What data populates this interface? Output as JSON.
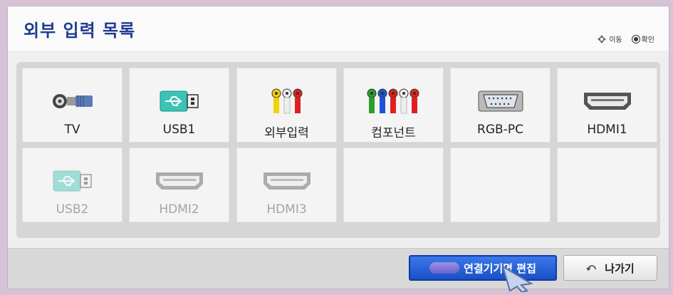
{
  "title": "외부 입력 목록",
  "hints": {
    "move": "이동",
    "ok": "확인"
  },
  "inputs": [
    {
      "label": "TV",
      "icon": "tv-antenna-icon",
      "enabled": true
    },
    {
      "label": "USB1",
      "icon": "usb-icon",
      "enabled": true
    },
    {
      "label": "외부입력",
      "icon": "av-rca-icon",
      "enabled": true
    },
    {
      "label": "컴포넌트",
      "icon": "component-icon",
      "enabled": true
    },
    {
      "label": "RGB-PC",
      "icon": "rgb-pc-icon",
      "enabled": true
    },
    {
      "label": "HDMI1",
      "icon": "hdmi-icon",
      "enabled": true
    },
    {
      "label": "USB2",
      "icon": "usb-icon",
      "enabled": false
    },
    {
      "label": "HDMI2",
      "icon": "hdmi-icon",
      "enabled": false
    },
    {
      "label": "HDMI3",
      "icon": "hdmi-icon",
      "enabled": false
    },
    {
      "label": "",
      "icon": "",
      "enabled": false
    },
    {
      "label": "",
      "icon": "",
      "enabled": false
    },
    {
      "label": "",
      "icon": "",
      "enabled": false
    }
  ],
  "buttons": {
    "edit": "연결기기명 편집",
    "exit": "나가기"
  },
  "colors": {
    "title": "#1f3b94",
    "edit_button": "#2a63dc",
    "background": "#d7c3d7"
  }
}
